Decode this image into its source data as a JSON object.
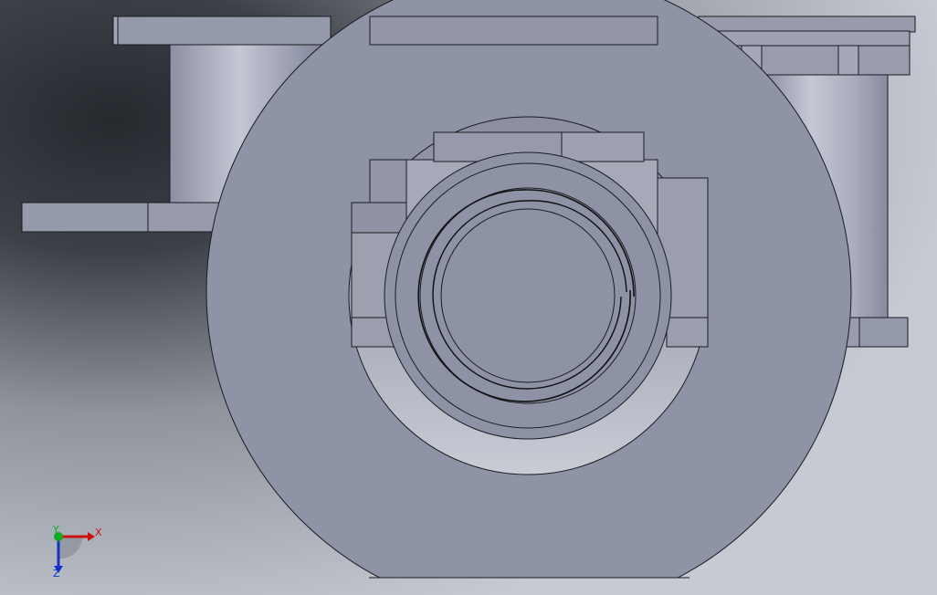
{
  "app": {
    "view": "cad-graphics-viewport"
  },
  "colors": {
    "background_dark": "#2a2e33",
    "background_light": "#c4c8d2",
    "part_face": "#8f93a6",
    "part_face_light": "#a3a7b8",
    "part_edge": "#1b1b22",
    "bore_highlight": "#b9bdc8",
    "axis_x": "#cc1111",
    "axis_y": "#11aa22",
    "axis_z": "#1133cc"
  },
  "triad": {
    "x_label": "X",
    "y_label": "Y",
    "z_label": "Z",
    "icon": "coordinate-triad-icon"
  }
}
